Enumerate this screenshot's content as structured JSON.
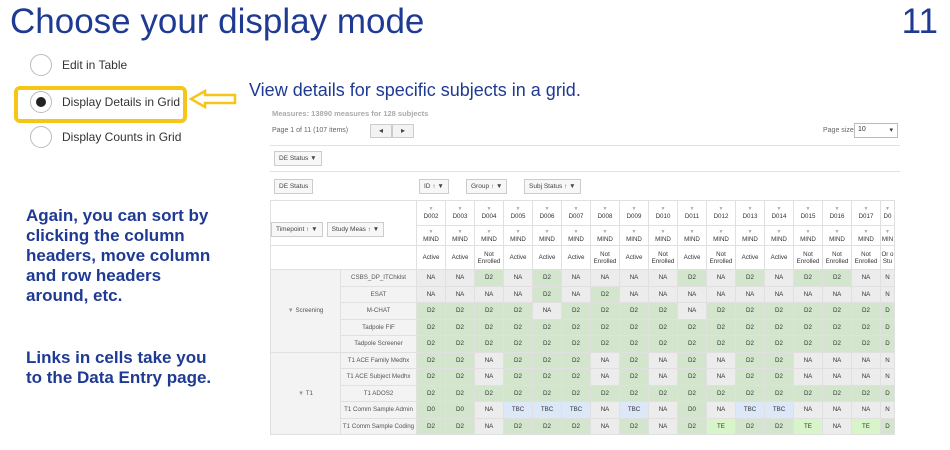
{
  "title": "Choose your display mode",
  "slide_number": "11",
  "radio_options": [
    {
      "label": "Edit in Table",
      "selected": false
    },
    {
      "label": "Display Details in Grid",
      "selected": true
    },
    {
      "label": "Display Counts in Grid",
      "selected": false
    }
  ],
  "subtitle": "View details for specific subjects in a grid.",
  "left_text": {
    "para1": [
      "Again, you can sort by",
      "clicking the column",
      "headers, move column",
      "and row headers",
      "around, etc."
    ],
    "para2": [
      "Links in cells take you",
      "to the Data Entry page."
    ]
  },
  "grid": {
    "measures_summary": "Measures: 13890 measures for 128 subjects",
    "page_info": "Page 1 of 11 (107 items)",
    "pager": {
      "prev": "◂",
      "next": "▸"
    },
    "page_size_label": "Page size:",
    "page_size_value": "10",
    "chips": {
      "de_status_filter": "DE Status",
      "de_status": "DE Status",
      "id": "ID",
      "group": "Group",
      "subj_status": "Subj Status",
      "timepoint": "Timepoint",
      "study_meas": "Study Meas"
    },
    "subjects": [
      "D002",
      "D003",
      "D004",
      "D005",
      "D006",
      "D007",
      "D008",
      "D009",
      "D010",
      "D011",
      "D012",
      "D013",
      "D014",
      "D015",
      "D016",
      "D017",
      "D0"
    ],
    "groups": [
      "MIND",
      "MIND",
      "MIND",
      "MIND",
      "MIND",
      "MIND",
      "MIND",
      "MIND",
      "MIND",
      "MIND",
      "MIND",
      "MIND",
      "MIND",
      "MIND",
      "MIND",
      "MIND",
      "MIN"
    ],
    "statuses": [
      "Active",
      "Active",
      "Not Enrolled",
      "Active",
      "Active",
      "Active",
      "Not Enrolled",
      "Active",
      "Not Enrolled",
      "Active",
      "Not Enrolled",
      "Active",
      "Active",
      "Not Enrolled",
      "Not Enrolled",
      "Not Enrolled",
      "Or o Stu"
    ],
    "timepoints": [
      {
        "name": "Screening",
        "rows": [
          {
            "measure": "CSBS_DP_ITChklst",
            "cells": [
              "NA",
              "NA",
              "D2",
              "NA",
              "D2",
              "NA",
              "NA",
              "NA",
              "NA",
              "D2",
              "NA",
              "D2",
              "NA",
              "D2",
              "D2",
              "NA",
              "N"
            ]
          },
          {
            "measure": "ESAT",
            "cells": [
              "NA",
              "NA",
              "NA",
              "NA",
              "D2",
              "NA",
              "D2",
              "NA",
              "NA",
              "NA",
              "NA",
              "NA",
              "NA",
              "NA",
              "NA",
              "NA",
              "N"
            ]
          },
          {
            "measure": "M-CHAT",
            "cells": [
              "D2",
              "D2",
              "D2",
              "D2",
              "NA",
              "D2",
              "D2",
              "D2",
              "D2",
              "NA",
              "D2",
              "D2",
              "D2",
              "D2",
              "D2",
              "D2",
              "D"
            ]
          },
          {
            "measure": "Tadpole FIF",
            "cells": [
              "D2",
              "D2",
              "D2",
              "D2",
              "D2",
              "D2",
              "D2",
              "D2",
              "D2",
              "D2",
              "D2",
              "D2",
              "D2",
              "D2",
              "D2",
              "D2",
              "D"
            ]
          },
          {
            "measure": "Tadpole Screener",
            "cells": [
              "D2",
              "D2",
              "D2",
              "D2",
              "D2",
              "D2",
              "D2",
              "D2",
              "D2",
              "D2",
              "D2",
              "D2",
              "D2",
              "D2",
              "D2",
              "D2",
              "D"
            ]
          }
        ]
      },
      {
        "name": "T1",
        "rows": [
          {
            "measure": "T1 ACE Family Medhx",
            "cells": [
              "D2",
              "D2",
              "NA",
              "D2",
              "D2",
              "D2",
              "NA",
              "D2",
              "NA",
              "D2",
              "NA",
              "D2",
              "D2",
              "NA",
              "NA",
              "NA",
              "N"
            ]
          },
          {
            "measure": "T1 ACE Subject Medhx",
            "cells": [
              "D2",
              "D2",
              "NA",
              "D2",
              "D2",
              "D2",
              "NA",
              "D2",
              "NA",
              "D2",
              "NA",
              "D2",
              "D2",
              "NA",
              "NA",
              "NA",
              "N"
            ]
          },
          {
            "measure": "T1 ADOS2",
            "cells": [
              "D2",
              "D2",
              "D2",
              "D2",
              "D2",
              "D2",
              "D2",
              "D2",
              "D2",
              "D2",
              "D2",
              "D2",
              "D2",
              "D2",
              "D2",
              "D2",
              "D"
            ]
          },
          {
            "measure": "T1 Comm Sample Admin",
            "cells": [
              "D0",
              "D0",
              "NA",
              "TBC",
              "TBC",
              "TBC",
              "NA",
              "TBC",
              "NA",
              "D0",
              "NA",
              "TBC",
              "TBC",
              "NA",
              "NA",
              "NA",
              "N"
            ]
          },
          {
            "measure": "T1 Comm Sample Coding",
            "cells": [
              "D2",
              "D2",
              "NA",
              "D2",
              "D2",
              "D2",
              "NA",
              "D2",
              "NA",
              "D2",
              "TE",
              "D2",
              "D2",
              "TE",
              "NA",
              "TE",
              "D"
            ]
          }
        ]
      }
    ]
  },
  "colors": {
    "title_blue": "#1f3a93",
    "highlight_yellow": "#f5c518",
    "cell_na": "#ececec",
    "cell_d2": "#d3e6cd",
    "cell_tbc": "#dce7f7",
    "cell_te": "#d7f5c9"
  }
}
